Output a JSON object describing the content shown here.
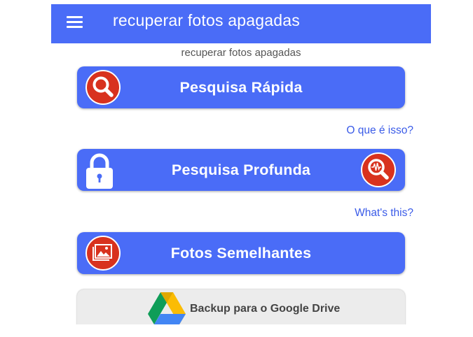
{
  "appbar": {
    "title": "recuperar fotos apagadas"
  },
  "subtitle": "recuperar fotos apagadas",
  "buttons": {
    "quick": "Pesquisa Rápida",
    "deep": "Pesquisa Profunda",
    "similar": "Fotos Semelhantes",
    "drive": "Backup para o Google Drive"
  },
  "links": {
    "what_pt": "O que é isso?",
    "what_en": "What's this?"
  },
  "icons": {
    "menu": "menu-icon",
    "quick": "magnifier-icon",
    "lock": "lock-icon",
    "deep": "magnifier-waveform-icon",
    "photos": "photo-gallery-icon",
    "drive": "google-drive-icon"
  },
  "colors": {
    "primary": "#4a6cf7",
    "icon_red": "#d8321e",
    "link": "#3a5be8",
    "drive_button": "#ececec"
  }
}
